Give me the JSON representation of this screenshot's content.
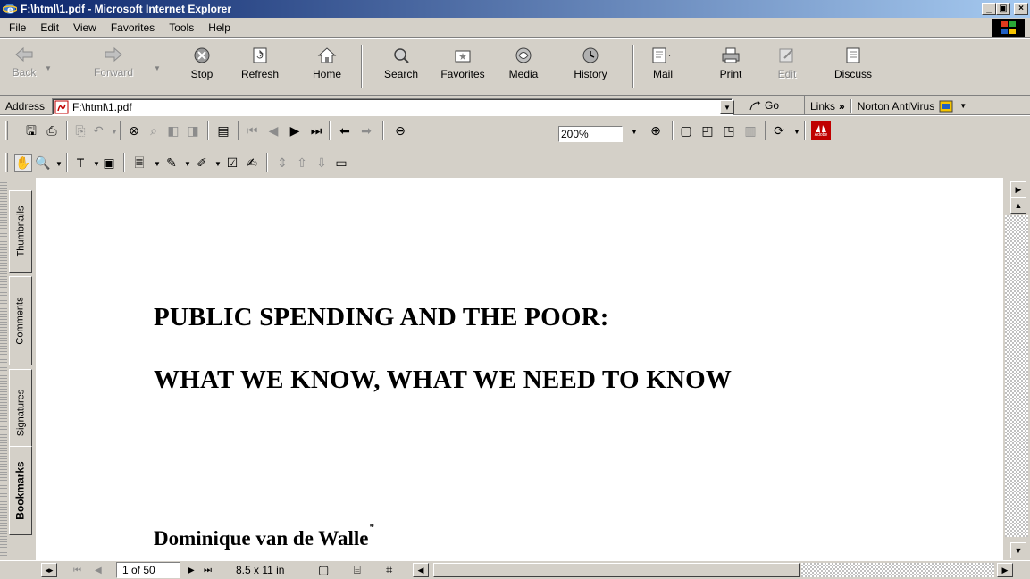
{
  "window": {
    "title": "F:\\html\\1.pdf - Microsoft Internet Explorer",
    "minimize_glyph": "_",
    "restore_glyph": "▣",
    "close_glyph": "×"
  },
  "menu": {
    "items": [
      "File",
      "Edit",
      "View",
      "Favorites",
      "Tools",
      "Help"
    ]
  },
  "toolbar": {
    "back": "Back",
    "forward": "Forward",
    "stop": "Stop",
    "refresh": "Refresh",
    "home": "Home",
    "search": "Search",
    "favorites": "Favorites",
    "media": "Media",
    "history": "History",
    "mail": "Mail",
    "print": "Print",
    "edit": "Edit",
    "discuss": "Discuss"
  },
  "address": {
    "label": "Address",
    "value": "F:\\html\\1.pdf",
    "go": "Go",
    "links": "Links",
    "links_chevron": "»",
    "norton": "Norton AntiVirus"
  },
  "acrobat": {
    "zoom": "200%",
    "adobe_label": "Adobe"
  },
  "sidetabs": [
    "Thumbnails",
    "Comments",
    "Signatures",
    "Bookmarks"
  ],
  "document": {
    "title_line1": "PUBLIC SPENDING AND THE POOR:",
    "title_line2": "WHAT WE KNOW, WHAT WE NEED TO KNOW",
    "author": "Dominique van de Walle",
    "author_mark": "*"
  },
  "statusbar": {
    "page_indicator": "1 of 50",
    "page_size": "8.5 x 11 in"
  },
  "colors": {
    "titlebar_start": "#0a246a",
    "titlebar_end": "#a6caf0",
    "chrome": "#d4d0c8",
    "document_bg": "#ffffff"
  }
}
